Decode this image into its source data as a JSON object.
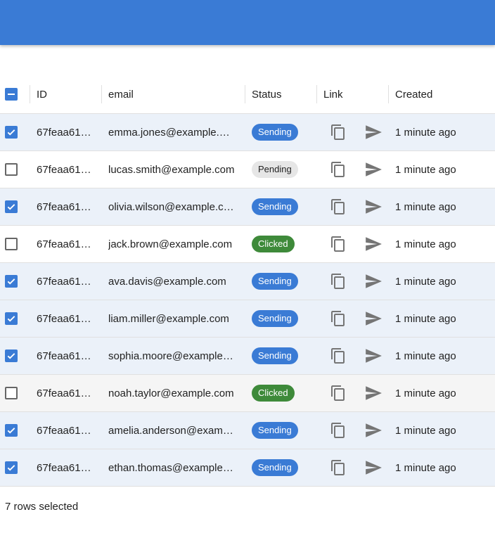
{
  "colors": {
    "appbar": "#3a7bd5",
    "sending": "#3a7bd5",
    "pending": "#e6e6e6",
    "clicked": "#3e8a3a",
    "selected_row": "#ebf1f9"
  },
  "header": {
    "select_all_state": "indeterminate",
    "id": "ID",
    "email": "email",
    "status": "Status",
    "link": "Link",
    "created": "Created"
  },
  "rows": [
    {
      "selected": true,
      "id": "67feaa61…",
      "email": "emma.jones@example.com",
      "status": "Sending",
      "status_kind": "sending",
      "created": "1 minute ago"
    },
    {
      "selected": false,
      "id": "67feaa61…",
      "email": "lucas.smith@example.com",
      "status": "Pending",
      "status_kind": "pending",
      "created": "1 minute ago"
    },
    {
      "selected": true,
      "id": "67feaa61…",
      "email": "olivia.wilson@example.com",
      "status": "Sending",
      "status_kind": "sending",
      "created": "1 minute ago"
    },
    {
      "selected": false,
      "id": "67feaa61…",
      "email": "jack.brown@example.com",
      "status": "Clicked",
      "status_kind": "clicked",
      "created": "1 minute ago"
    },
    {
      "selected": true,
      "id": "67feaa61…",
      "email": "ava.davis@example.com",
      "status": "Sending",
      "status_kind": "sending",
      "created": "1 minute ago"
    },
    {
      "selected": true,
      "id": "67feaa61…",
      "email": "liam.miller@example.com",
      "status": "Sending",
      "status_kind": "sending",
      "created": "1 minute ago"
    },
    {
      "selected": true,
      "id": "67feaa61…",
      "email": "sophia.moore@example.com",
      "status": "Sending",
      "status_kind": "sending",
      "created": "1 minute ago"
    },
    {
      "selected": false,
      "hovered": true,
      "id": "67feaa61…",
      "email": "noah.taylor@example.com",
      "status": "Clicked",
      "status_kind": "clicked",
      "created": "1 minute ago"
    },
    {
      "selected": true,
      "id": "67feaa61…",
      "email": "amelia.anderson@example.com",
      "status": "Sending",
      "status_kind": "sending",
      "created": "1 minute ago"
    },
    {
      "selected": true,
      "id": "67feaa61…",
      "email": "ethan.thomas@example.com",
      "status": "Sending",
      "status_kind": "sending",
      "created": "1 minute ago"
    }
  ],
  "icons": {
    "copy": "copy-icon",
    "send": "send-icon"
  },
  "footer": {
    "selection_text": "7 rows selected"
  }
}
